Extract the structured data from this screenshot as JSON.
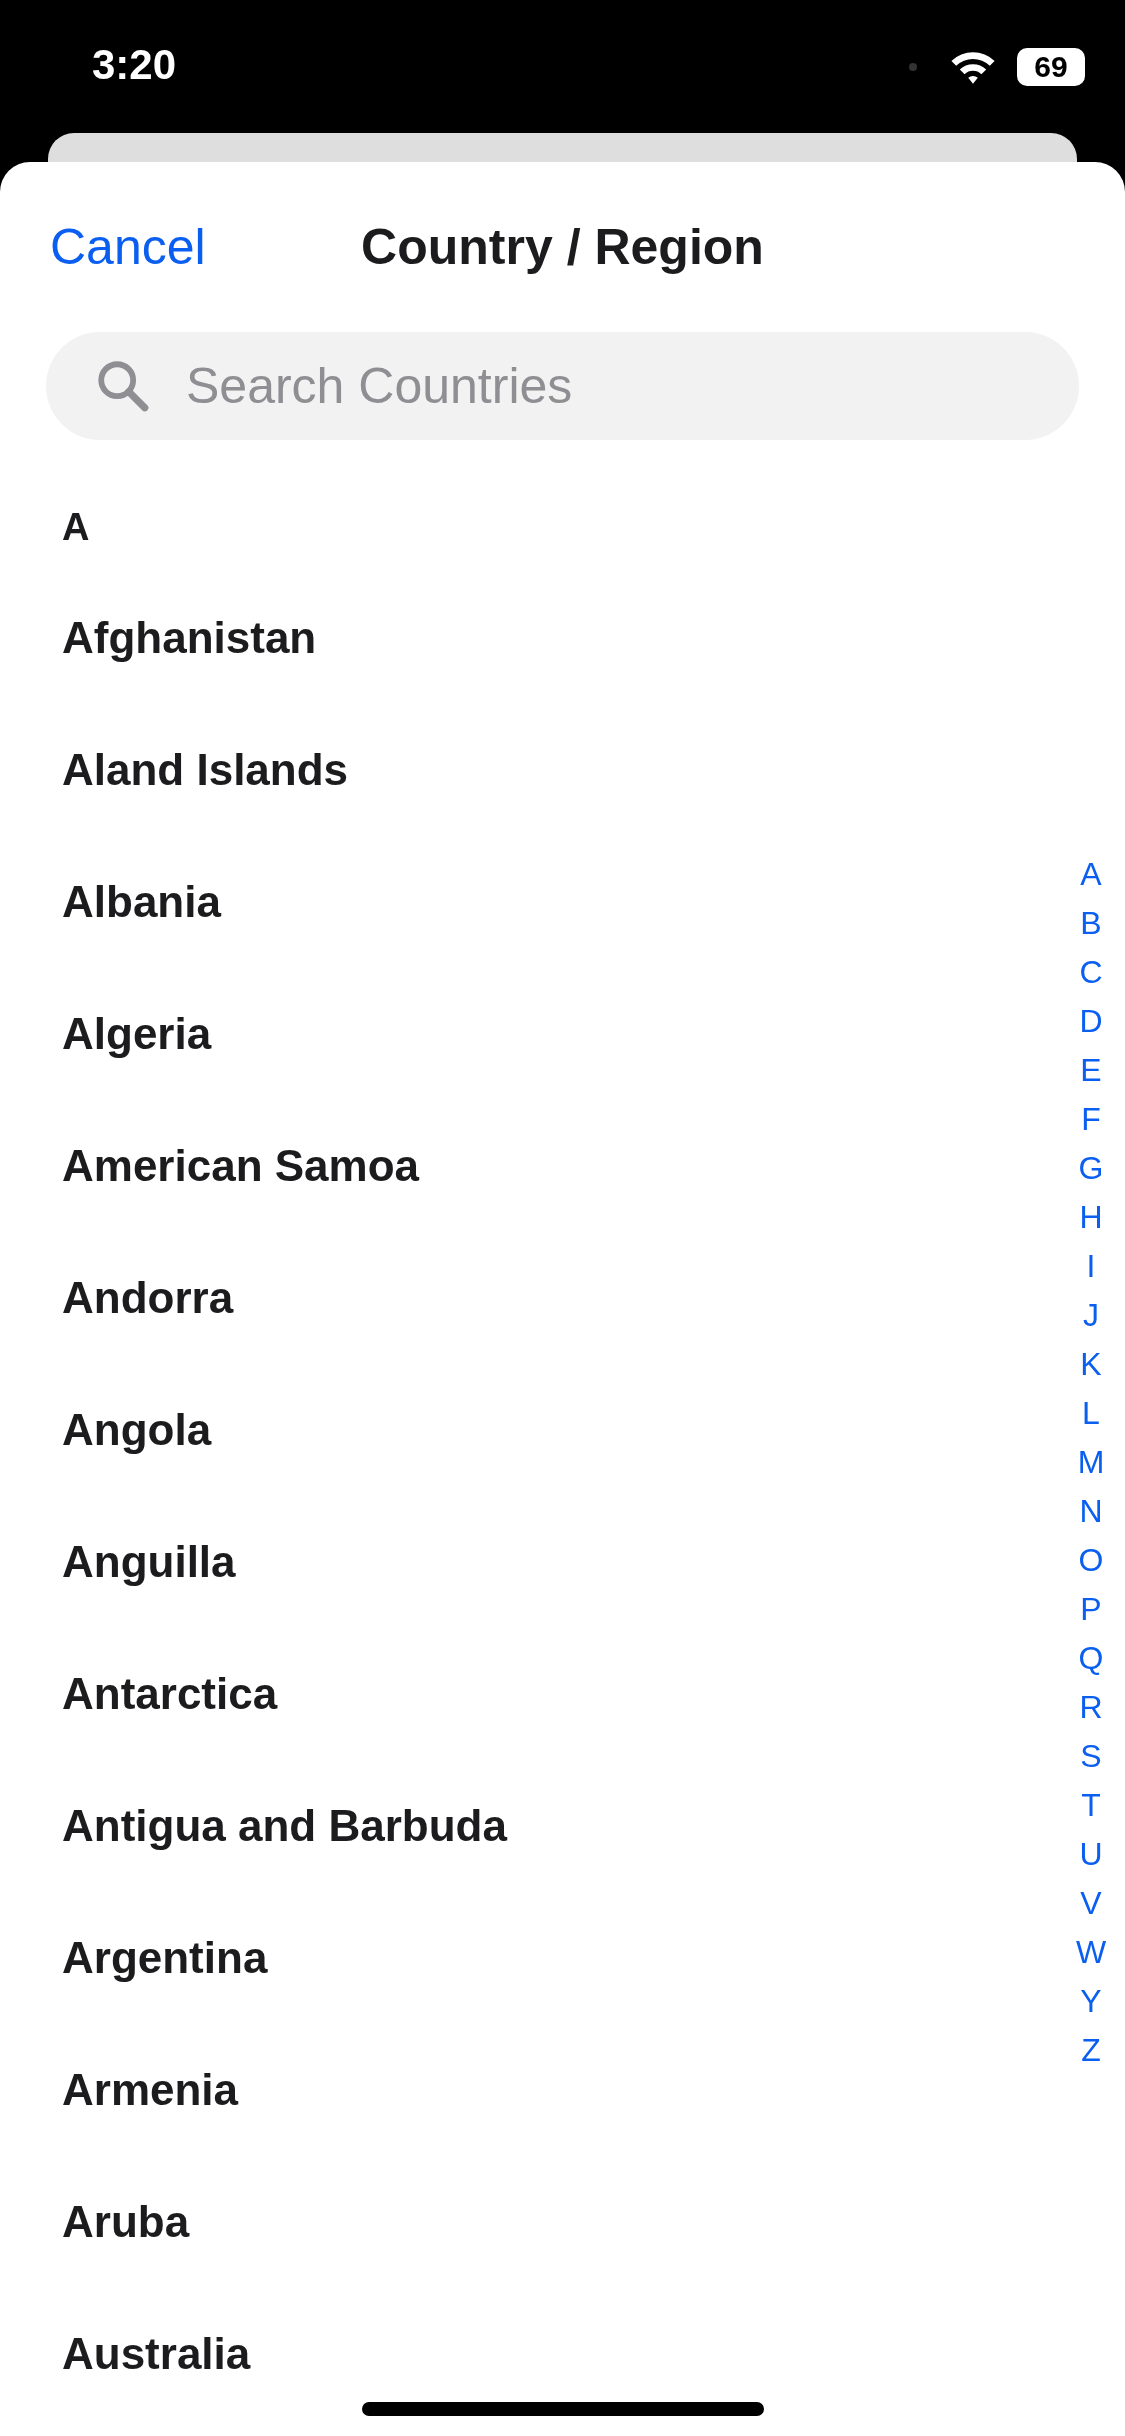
{
  "status_bar": {
    "time": "3:20",
    "battery": "69"
  },
  "nav": {
    "cancel": "Cancel",
    "title": "Country / Region"
  },
  "search": {
    "placeholder": "Search Countries"
  },
  "section": "A",
  "countries": [
    "Afghanistan",
    "Aland Islands",
    "Albania",
    "Algeria",
    "American Samoa",
    "Andorra",
    "Angola",
    "Anguilla",
    "Antarctica",
    "Antigua and Barbuda",
    "Argentina",
    "Armenia",
    "Aruba",
    "Australia"
  ],
  "index": [
    "A",
    "B",
    "C",
    "D",
    "E",
    "F",
    "G",
    "H",
    "I",
    "J",
    "K",
    "L",
    "M",
    "N",
    "O",
    "P",
    "Q",
    "R",
    "S",
    "T",
    "U",
    "V",
    "W",
    "Y",
    "Z"
  ]
}
